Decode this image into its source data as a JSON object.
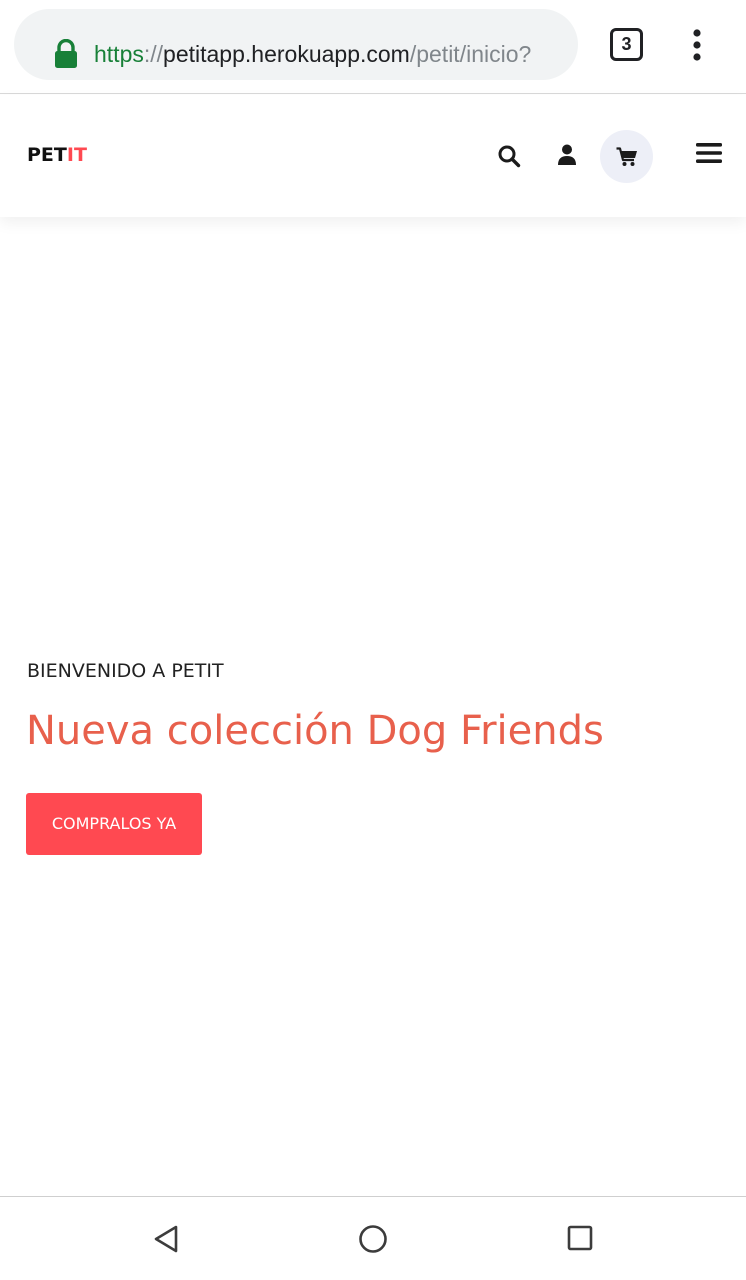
{
  "browser": {
    "url_scheme": "https",
    "url_sep": "://",
    "url_host": "petitapp.herokuapp.com",
    "url_path": "/petit/inicio?",
    "tab_count": "3",
    "icons": [
      "lock-icon",
      "kebab-menu-icon"
    ]
  },
  "header": {
    "logo_part1": "PET",
    "logo_part2": "IT",
    "icons": [
      "search-icon",
      "user-icon",
      "cart-icon",
      "hamburger-menu-icon"
    ]
  },
  "hero": {
    "kicker": "BIENVENIDO A PETIT",
    "title": "Nueva colección Dog Friends",
    "cta_label": "COMPRALOS YA"
  },
  "nav_bar": {
    "icons": [
      "back-icon",
      "home-icon",
      "recents-icon"
    ]
  },
  "colors": {
    "accent": "#ff4951",
    "title": "#e8604c",
    "secure_green": "#188038",
    "cart_bg": "#edeff7"
  }
}
